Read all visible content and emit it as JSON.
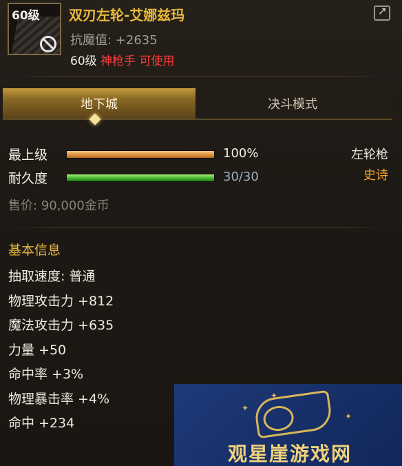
{
  "item": {
    "level_badge": "60级",
    "name": "双刃左轮-艾娜兹玛",
    "stat": "抗魔值: +2635",
    "req_level": "60级",
    "req_class": "神枪手 可使用"
  },
  "tabs": [
    {
      "label": "地下城",
      "active": true
    },
    {
      "label": "决斗模式",
      "active": false
    }
  ],
  "bars": {
    "level": {
      "label": "最上级",
      "value_text": "100%",
      "fill": 1.0
    },
    "durability": {
      "label": "耐久度",
      "value_text": "30/30",
      "fill": 1.0
    }
  },
  "type_name": "左轮枪",
  "rarity": "史诗",
  "price": "售价: 90,000金币",
  "section_title": "基本信息",
  "attributes": [
    "抽取速度: 普通",
    "物理攻击力 +812",
    "魔法攻击力 +635",
    "力量 +50",
    "命中率 +3%",
    "物理暴击率 +4%",
    "命中 +234"
  ],
  "watermark": {
    "text": "观星崖游戏网"
  },
  "colors": {
    "name_gold": "#e8b93a",
    "class_red": "#ff3b3b",
    "rarity_orange": "#f0a52c",
    "bar_orange": "#dc8e3a",
    "bar_green": "#3fb02b"
  },
  "icons": {
    "share": "share-icon",
    "forbidden": "forbidden-icon",
    "weapon": "revolver-icon"
  }
}
